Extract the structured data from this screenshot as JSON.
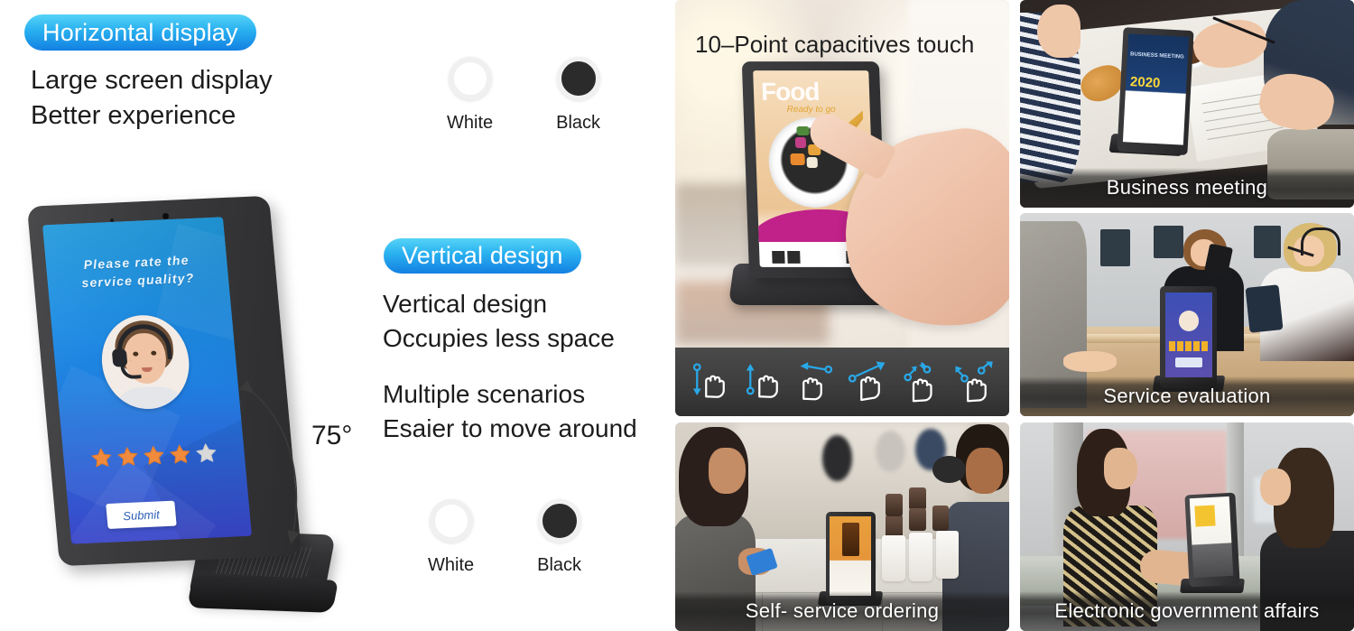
{
  "left": {
    "horizontal_pill": "Horizontal display",
    "horizontal_copy": "Large screen display\nBetter experience",
    "vertical_pill": "Vertical design",
    "vertical_copy_1": "Vertical design\nOccupies less space",
    "vertical_copy_2": "Multiple scenarios\nEsaier to move around",
    "angle_label": "75°"
  },
  "colors": {
    "top": [
      {
        "name": "white-swatch",
        "label": "White",
        "hex": "#ffffff"
      },
      {
        "name": "black-swatch",
        "label": "Black",
        "hex": "#2b2b2b"
      }
    ],
    "bottom": [
      {
        "name": "white-swatch",
        "label": "White",
        "hex": "#ffffff"
      },
      {
        "name": "black-swatch",
        "label": "Black",
        "hex": "#2b2b2b"
      }
    ]
  },
  "device_screen": {
    "title": "Please rate the\nservice quality?",
    "avatar_alt": "female customer service agent with headset",
    "stars_filled": 4,
    "stars_total": 5,
    "star_color": "#f08a3c",
    "star_empty_color": "#d9d9d9",
    "submit_label": "Submit"
  },
  "touch_panel": {
    "headline": "10–Point capacitives touch",
    "tablet_screen_word": "Food",
    "tablet_screen_sub": "Ready to go",
    "gestures": [
      "swipe-down-gesture-icon",
      "swipe-up-gesture-icon",
      "swipe-left-gesture-icon",
      "swipe-up-right-gesture-icon",
      "pinch-out-gesture-icon",
      "pinch-in-gesture-icon"
    ]
  },
  "scenes": [
    {
      "name": "panel-meeting",
      "caption": "Business meeting",
      "screen_headline": "BUSINESS MEETING",
      "screen_year": "2020"
    },
    {
      "name": "panel-service",
      "caption": "Service evaluation"
    },
    {
      "name": "panel-order",
      "caption": "Self- service ordering"
    },
    {
      "name": "panel-gov",
      "caption": "Electronic government affairs"
    }
  ],
  "theme": {
    "pill_from": "#56d3f7",
    "pill_to": "#1380e2",
    "text": "#1c1c1c",
    "caption_text": "#ffffff",
    "screen_blue_top": "#1a9fe8",
    "screen_blue_bottom": "#3b46c9"
  }
}
